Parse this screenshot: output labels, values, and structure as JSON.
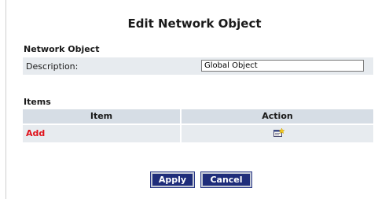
{
  "page": {
    "title": "Edit Network Object"
  },
  "network_object": {
    "heading": "Network Object",
    "description_label": "Description:",
    "description_value": "Global Object"
  },
  "items": {
    "heading": "Items",
    "columns": [
      "Item",
      "Action"
    ],
    "add_label": "Add",
    "add_icon": "add-item-icon"
  },
  "buttons": {
    "apply": "Apply",
    "cancel": "Cancel"
  },
  "colors": {
    "row_background": "#e7ebef",
    "header_background": "#d6dde5",
    "add_link": "#e0121b",
    "button_background": "#1f2d7a"
  }
}
